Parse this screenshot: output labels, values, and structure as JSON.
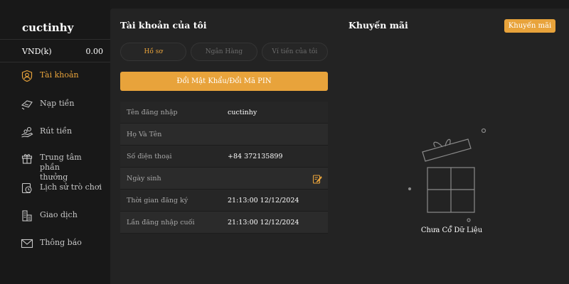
{
  "account": {
    "username": "cuctinhy",
    "currency_label": "VND(k)",
    "balance": "0.00"
  },
  "sidebar": {
    "items": [
      {
        "label": "Tài khoản",
        "icon": "user-shield-icon",
        "active": true
      },
      {
        "label": "Nạp tiền",
        "icon": "deposit-icon"
      },
      {
        "label": "Rút tiền",
        "icon": "withdraw-icon"
      },
      {
        "label": "Trung tâm phần thưởng",
        "icon": "gift-icon"
      },
      {
        "label": "Lịch sử trò chơi",
        "icon": "history-icon"
      },
      {
        "label": "Giao dịch",
        "icon": "transactions-icon"
      },
      {
        "label": "Thông báo",
        "icon": "mail-icon"
      }
    ]
  },
  "my_account": {
    "title": "Tài khoản của tôi",
    "tabs": [
      "Hồ sơ",
      "Ngân Hàng",
      "Ví tiền của tôi"
    ],
    "change_password_label": "Đổi Mật Khẩu/Đổi Mã PIN",
    "rows": [
      {
        "key": "Tên đăng nhập",
        "value": "cuctinhy"
      },
      {
        "key": "Họ Và Tên",
        "value": ""
      },
      {
        "key": "Số điện thoại",
        "value": "+84 372135899"
      },
      {
        "key": "Ngày sinh",
        "value": ""
      },
      {
        "key": "Thời gian đăng ký",
        "value": "21:13:00 12/12/2024"
      },
      {
        "key": "Lần đăng nhập cuối",
        "value": "21:13:00 12/12/2024"
      }
    ]
  },
  "promotions": {
    "title": "Khuyến mãi",
    "button_label": "Khuyến mãi",
    "empty_text": "Chưa Có Dữ Liệu"
  },
  "colors": {
    "accent": "#e8a33b",
    "background": "#1a1a1a",
    "panel": "#232323"
  }
}
